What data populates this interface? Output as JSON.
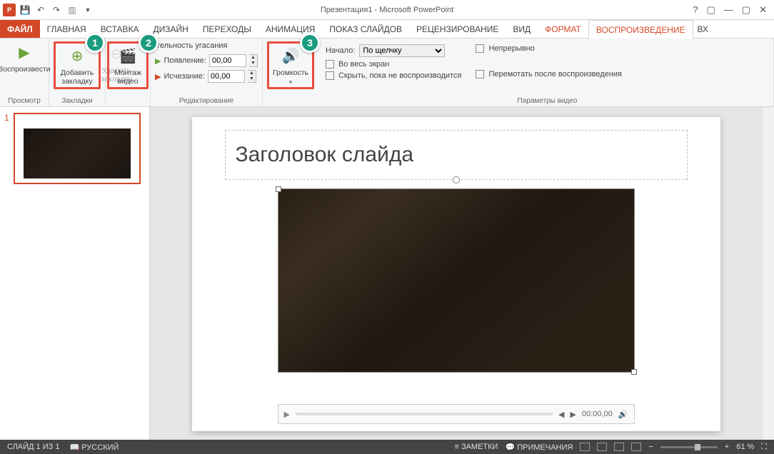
{
  "titlebar": {
    "title": "Презентация1 - Microsoft PowerPoint"
  },
  "wincontrols": {
    "help": "?",
    "opts": "▢",
    "min": "—",
    "max": "▢",
    "close": "✕"
  },
  "tabs": {
    "file": "ФАЙЛ",
    "items": [
      "ГЛАВНАЯ",
      "ВСТАВКА",
      "ДИЗАЙН",
      "ПЕРЕХОДЫ",
      "АНИМАЦИЯ",
      "ПОКАЗ СЛАЙДОВ",
      "РЕЦЕНЗИРОВАНИЕ",
      "ВИД",
      "ФОРМАТ",
      "ВОСПРОИЗВЕДЕНИЕ"
    ],
    "overflow": "Вх"
  },
  "ribbon": {
    "preview": {
      "btn": "Воспроизвести",
      "group": "Просмотр"
    },
    "bookmarks": {
      "add": "Добавить закладку",
      "remove": "Удалить закладку",
      "group": "Закладки"
    },
    "trim": {
      "btn": "Монтаж видео"
    },
    "edit": {
      "duration_label": "тельность угасания",
      "appear": "Появление:",
      "appear_val": "00,00",
      "disappear": "Исчезание:",
      "disappear_val": "00,00",
      "group": "Редактирование"
    },
    "volume": {
      "btn": "Громкость"
    },
    "video": {
      "start_label": "Начало:",
      "start_val": "По щелчку",
      "fullscreen": "Во весь экран",
      "hide": "Скрыть, пока не воспроизводится",
      "loop": "Непрерывно",
      "rewind": "Перемотать после воспроизведения",
      "group": "Параметры видео"
    }
  },
  "badges": {
    "b1": "1",
    "b2": "2",
    "b3": "3"
  },
  "thumbs": {
    "num1": "1"
  },
  "slide": {
    "title": "Заголовок слайда"
  },
  "player": {
    "play": "▶",
    "prev": "◀",
    "next": "▶",
    "time": "00:00,00",
    "vol": "🔊"
  },
  "status": {
    "slide": "СЛАЙД 1 ИЗ 1",
    "lang": "РУССКИЙ",
    "notes": "ЗАМЕТКИ",
    "comments": "ПРИМЕЧАНИЯ",
    "zoom": "61 %"
  }
}
